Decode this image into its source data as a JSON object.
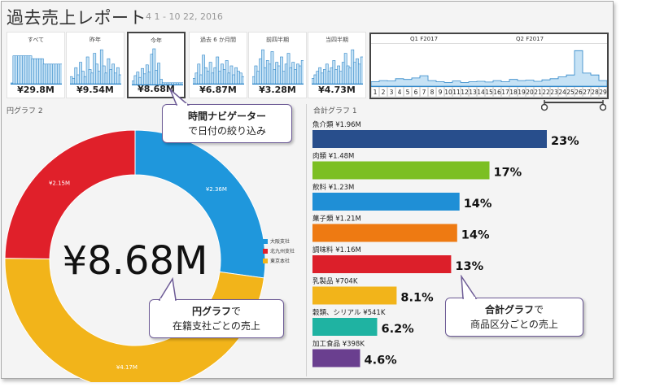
{
  "header": {
    "title": "過去売上レポート",
    "date_range": "4 1 - 10 22, 2016"
  },
  "tiles": [
    {
      "label": "すべて",
      "value": "¥29.8M",
      "selected": false,
      "bars": [
        0.0,
        0.78,
        0.78,
        0.78,
        0.78,
        0.78,
        0.78,
        0.78,
        0.78,
        0.7,
        0.7,
        0.7,
        0.7,
        0.7,
        0.55,
        0.55,
        0.55,
        0.55,
        0.55,
        0.55,
        0.55,
        0.55
      ]
    },
    {
      "label": "昨年",
      "value": "¥9.54M",
      "selected": false,
      "bars": [
        0.2,
        0.15,
        0.45,
        0.25,
        0.6,
        0.35,
        0.2,
        0.75,
        0.4,
        0.3,
        0.85,
        0.55,
        0.35,
        0.95,
        0.5,
        0.3,
        0.7,
        0.4,
        0.55,
        0.3,
        0.45,
        0.25
      ]
    },
    {
      "label": "今年",
      "value": "¥8.68M",
      "selected": true,
      "bars": [
        0.1,
        0.25,
        0.35,
        0.2,
        0.45,
        0.3,
        0.55,
        0.35,
        0.85,
        1.0,
        0.4,
        0.6,
        0.15,
        0.05,
        0.05,
        0.05,
        0.05,
        0.05,
        0.05,
        0.05,
        0.05,
        0.05
      ]
    },
    {
      "label": "過去 6 か月間",
      "value": "¥6.87M",
      "selected": false,
      "bars": [
        0.15,
        0.3,
        0.55,
        0.25,
        0.8,
        0.45,
        0.35,
        0.6,
        0.3,
        0.45,
        0.75,
        0.35,
        0.55,
        0.4,
        0.65,
        0.3,
        0.5,
        0.25,
        0.45,
        0.35,
        0.3,
        0.2
      ]
    },
    {
      "label": "前四半期",
      "value": "¥3.28M",
      "selected": false,
      "bars": [
        0.2,
        0.5,
        0.35,
        0.7,
        0.95,
        0.45,
        0.65,
        0.55,
        0.9,
        0.4,
        0.6,
        0.5,
        0.75,
        0.35,
        0.55,
        0.85,
        0.45,
        0.6,
        0.4,
        0.55,
        0.5,
        0.65
      ]
    },
    {
      "label": "当四半期",
      "value": "¥4.73M",
      "selected": false,
      "bars": [
        0.15,
        0.25,
        0.35,
        0.45,
        0.3,
        0.4,
        0.55,
        0.35,
        0.45,
        0.65,
        0.4,
        0.5,
        0.35,
        0.6,
        0.85,
        0.5,
        0.45,
        0.95,
        0.6,
        0.7,
        0.55,
        0.75
      ]
    }
  ],
  "timeline": {
    "quarters": [
      "Q1 F2017",
      "Q2 F2017"
    ],
    "weeks": [
      "1",
      "2",
      "3",
      "4",
      "5",
      "6",
      "7",
      "8",
      "9",
      "10",
      "11",
      "12",
      "13",
      "14",
      "15",
      "16",
      "17",
      "18",
      "19",
      "20",
      "21",
      "22",
      "23",
      "24",
      "25",
      "26",
      "27",
      "28",
      "29"
    ],
    "values": [
      0.12,
      0.15,
      0.14,
      0.2,
      0.18,
      0.22,
      0.28,
      0.15,
      0.12,
      0.1,
      0.14,
      0.1,
      0.12,
      0.13,
      0.11,
      0.15,
      0.12,
      0.18,
      0.15,
      0.16,
      0.13,
      0.17,
      0.2,
      0.25,
      0.3,
      0.95,
      0.35,
      0.3,
      0.15
    ]
  },
  "pie": {
    "title": "円グラフ 2",
    "center_value": "¥8.68M",
    "slices": [
      {
        "name": "大阪支社",
        "value": 2.36,
        "label": "¥2.36M",
        "color": "#1f97dc"
      },
      {
        "name": "東京本社",
        "value": 4.17,
        "label": "¥4.17M",
        "color": "#f2b41a"
      },
      {
        "name": "北九州支社",
        "value": 2.15,
        "label": "¥2.15M",
        "color": "#e0202a"
      }
    ],
    "legend": [
      {
        "name": "大阪支社",
        "color": "#1f97dc"
      },
      {
        "name": "北九州支社",
        "color": "#e0202a"
      },
      {
        "name": "東京本社",
        "color": "#f2b41a"
      }
    ]
  },
  "bar_chart": {
    "title": "合計グラフ 1",
    "items": [
      {
        "label": "魚介類 ¥1.96M",
        "value": 1.96,
        "pct": "23%",
        "color": "#284e8c"
      },
      {
        "label": "肉類 ¥1.48M",
        "value": 1.48,
        "pct": "17%",
        "color": "#7cbf23"
      },
      {
        "label": "飲料 ¥1.23M",
        "value": 1.23,
        "pct": "14%",
        "color": "#1f8fd6"
      },
      {
        "label": "菓子類 ¥1.21M",
        "value": 1.21,
        "pct": "14%",
        "color": "#ee7a12"
      },
      {
        "label": "調味料 ¥1.16M",
        "value": 1.16,
        "pct": "13%",
        "color": "#dc1f2a"
      },
      {
        "label": "乳製品 ¥704K",
        "value": 0.704,
        "pct": "8.1%",
        "color": "#f2b41a"
      },
      {
        "label": "穀類、シリアル ¥541K",
        "value": 0.541,
        "pct": "6.2%",
        "color": "#1fb3a2"
      },
      {
        "label": "加工食品 ¥398K",
        "value": 0.398,
        "pct": "4.6%",
        "color": "#6a3f8f"
      }
    ]
  },
  "callouts": {
    "timeline_bold": "時間ナビゲーター",
    "timeline_rest": "で日付の絞り込み",
    "pie_bold": "円グラフ",
    "pie_mid": "で",
    "pie_rest": "在籍支社ごとの売上",
    "bar_bold": "合計グラフ",
    "bar_mid": "で",
    "bar_rest": "商品区分ごとの売上"
  }
}
